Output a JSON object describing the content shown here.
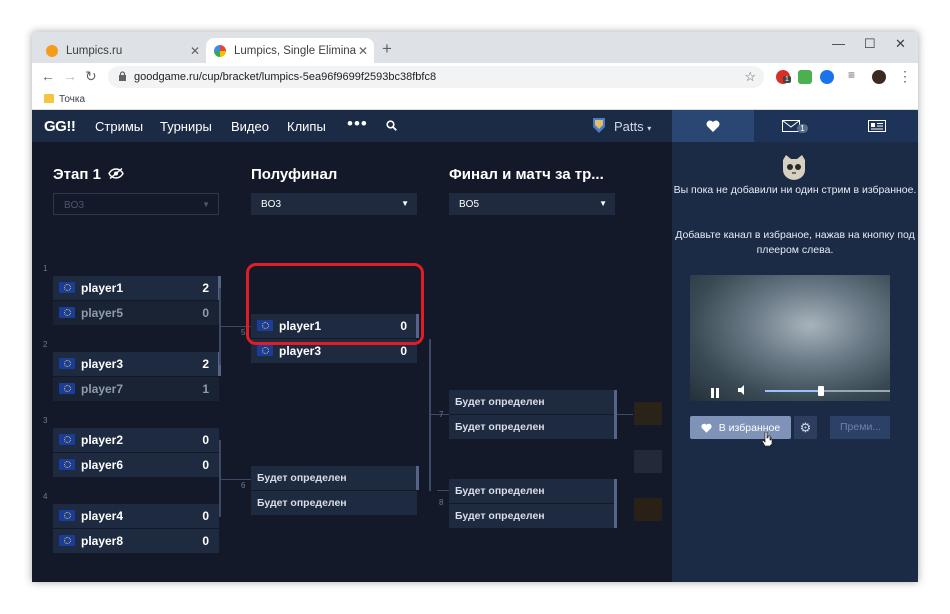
{
  "browser": {
    "tabs": [
      {
        "title": "Lumpics.ru",
        "favicon_color": "#f59c1a"
      },
      {
        "title": "Lumpics, Single Elimination — re",
        "favicon_color": "#4285f4"
      }
    ],
    "new_tab_label": "+",
    "address": "goodgame.ru/cup/bracket/lumpics-5ea96f9699f2593bc38fbfc8",
    "bookmark": "Точка",
    "extension_badge": "1"
  },
  "site": {
    "logo": "GG!!",
    "nav": [
      "Стримы",
      "Турниры",
      "Видео",
      "Клипы"
    ],
    "more": "•••",
    "username": "Patts",
    "mail_count": "1"
  },
  "bracket": {
    "rounds": [
      {
        "title": "Этап 1",
        "format": "BO3"
      },
      {
        "title": "Полуфинал",
        "format": "BO3"
      },
      {
        "title": "Финал и матч за тр...",
        "format": "BO5"
      }
    ],
    "round1": [
      {
        "num": "1",
        "a": {
          "name": "player1",
          "score": "2"
        },
        "b": {
          "name": "player5",
          "score": "0"
        }
      },
      {
        "num": "2",
        "a": {
          "name": "player3",
          "score": "2"
        },
        "b": {
          "name": "player7",
          "score": "1"
        }
      },
      {
        "num": "3",
        "a": {
          "name": "player2",
          "score": "0"
        },
        "b": {
          "name": "player6",
          "score": "0"
        }
      },
      {
        "num": "4",
        "a": {
          "name": "player4",
          "score": "0"
        },
        "b": {
          "name": "player8",
          "score": "0"
        }
      }
    ],
    "semis": [
      {
        "num": "5",
        "a": {
          "name": "player1",
          "score": "0"
        },
        "b": {
          "name": "player3",
          "score": "0"
        }
      },
      {
        "num": "6",
        "a": {
          "name": "Будет определен"
        },
        "b": {
          "name": "Будет определен"
        }
      }
    ],
    "finals": [
      {
        "num": "7",
        "a": {
          "name": "Будет определен"
        },
        "b": {
          "name": "Будет определен"
        }
      },
      {
        "num": "8",
        "a": {
          "name": "Будет определен"
        },
        "b": {
          "name": "Будет определен"
        }
      }
    ]
  },
  "sidebar": {
    "empty_text": "Вы пока не добавили ни один стрим в избранное.",
    "hint_text": "Добавьте канал в избраное, нажав на кнопку под плеером слева.",
    "video_progress": 0.45,
    "favorite_button": "В избранное",
    "premium_button": "Преми..."
  },
  "colors": {
    "accent": "#1b2a45",
    "highlight": "#e01c24"
  }
}
